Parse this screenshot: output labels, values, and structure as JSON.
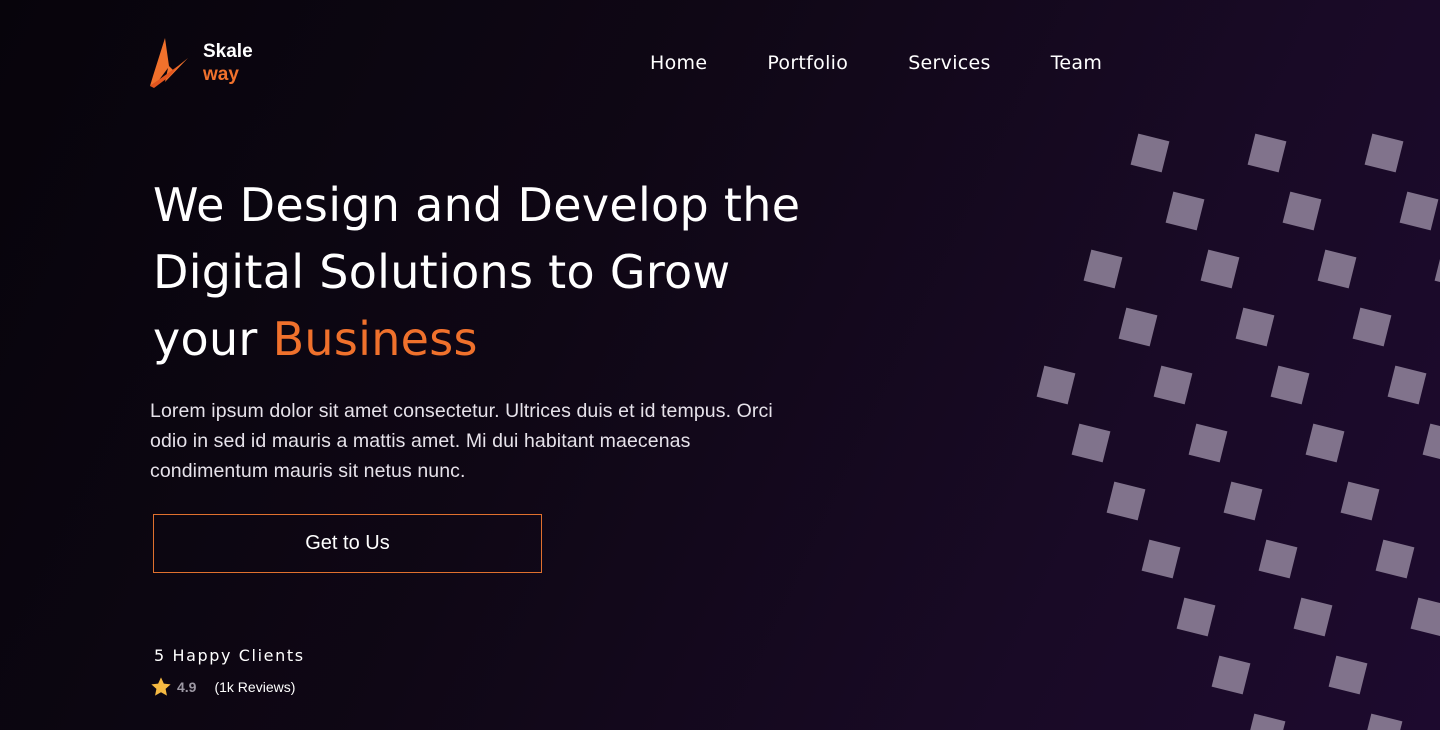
{
  "brand": {
    "name_line1": "Skale",
    "name_line2": "way",
    "logo_icon": "flame-logo-icon",
    "accent_color": "#f0712c"
  },
  "nav": {
    "items": [
      {
        "label": "Home"
      },
      {
        "label": "Portfolio"
      },
      {
        "label": "Services"
      },
      {
        "label": "Team"
      }
    ]
  },
  "hero": {
    "title_line1": "We Design and Develop the",
    "title_line2": "Digital Solutions to Grow",
    "title_line3_prefix": "your ",
    "title_highlight": "Business",
    "description": "Lorem ipsum dolor sit amet consectetur. Ultrices duis et id tempus. Orci odio in sed id mauris a mattis amet. Mi dui habitant maecenas condimentum mauris sit netus nunc.",
    "cta_label": "Get to Us"
  },
  "social_proof": {
    "clients_text": "5 Happy Clients",
    "rating": "4.9",
    "reviews_text": "(1k Reviews)",
    "star_icon": "star-icon",
    "star_color": "#f5b942"
  },
  "decoration": {
    "pattern_icon": "square-pattern-decoration",
    "square_color": "#8a7d95"
  }
}
